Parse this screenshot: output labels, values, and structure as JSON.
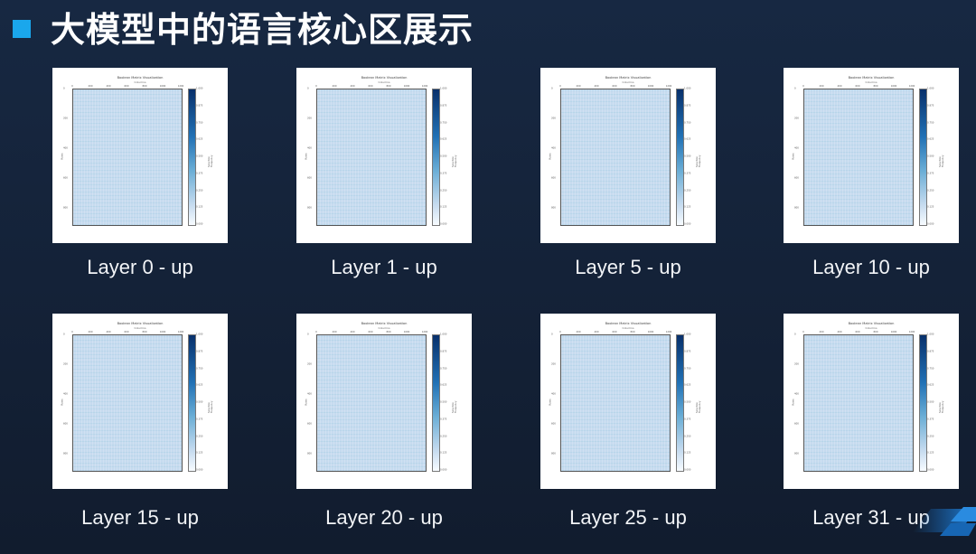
{
  "header": {
    "title": "大模型中的语言核心区展示",
    "accent_color": "#1aa7ec"
  },
  "chart_template": {
    "title": "Boolean Matrix Visualization",
    "xlabel": "Columns",
    "ylabel": "Rows",
    "xticks": [
      "0",
      "200",
      "400",
      "600",
      "800",
      "1000",
      "1200"
    ],
    "yticks": [
      "0",
      "200",
      "400",
      "600",
      "800"
    ],
    "colorbar_ticks": [
      "1.000",
      "0.875",
      "0.750",
      "0.625",
      "0.500",
      "0.375",
      "0.250",
      "0.125",
      "0.000"
    ],
    "colorbar_label": "Selection Frequency",
    "colormap": "Blues"
  },
  "panels": [
    {
      "caption": "Layer 0 - up"
    },
    {
      "caption": "Layer 1 - up"
    },
    {
      "caption": "Layer 5 - up"
    },
    {
      "caption": "Layer 10 - up"
    },
    {
      "caption": "Layer 15 - up"
    },
    {
      "caption": "Layer 20 - up"
    },
    {
      "caption": "Layer 25 - up"
    },
    {
      "caption": "Layer 31 - up"
    }
  ]
}
